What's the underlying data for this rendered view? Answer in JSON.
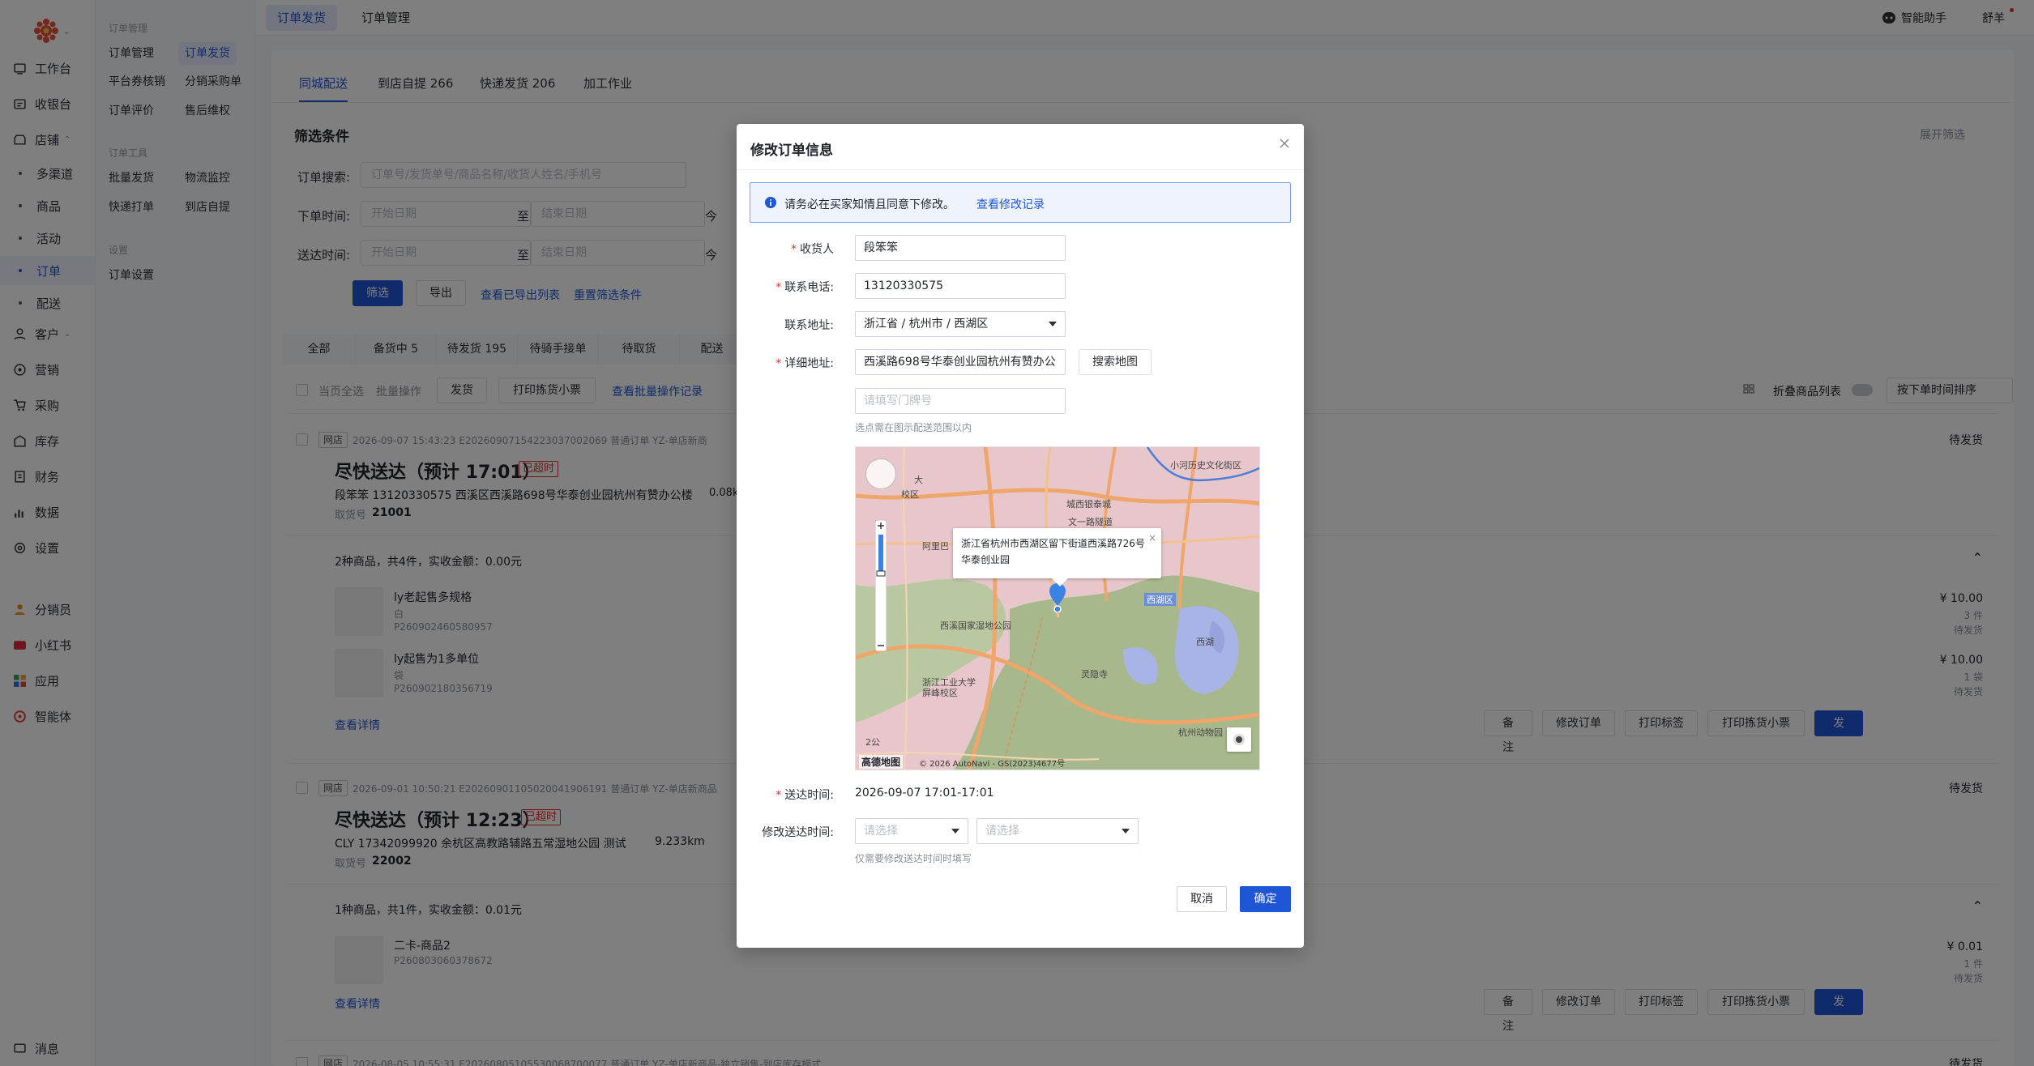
{
  "sidebar": {
    "items": [
      {
        "label": "工作台",
        "icon": "home-icon"
      },
      {
        "label": "收银台",
        "icon": "register-icon"
      },
      {
        "label": "店铺",
        "icon": "store-icon"
      },
      {
        "label": "多渠道",
        "sub": true
      },
      {
        "label": "商品",
        "sub": true
      },
      {
        "label": "活动",
        "sub": true
      },
      {
        "label": "订单",
        "sub": true,
        "active": true
      },
      {
        "label": "配送",
        "sub": true
      },
      {
        "label": "客户",
        "icon": "customer-icon"
      },
      {
        "label": "营销",
        "icon": "marketing-icon"
      },
      {
        "label": "采购",
        "icon": "cart-icon"
      },
      {
        "label": "库存",
        "icon": "inventory-icon"
      },
      {
        "label": "财务",
        "icon": "finance-icon"
      },
      {
        "label": "数据",
        "icon": "chart-icon"
      },
      {
        "label": "设置",
        "icon": "gear-icon"
      },
      {
        "label": "分销员",
        "icon": "distributor-icon"
      },
      {
        "label": "小红书",
        "icon": "xiaohongshu-icon"
      },
      {
        "label": "应用",
        "icon": "apps-icon"
      },
      {
        "label": "智能体",
        "icon": "agent-icon"
      }
    ],
    "message_label": "消息"
  },
  "subnav": {
    "group1": "订单管理",
    "group2": "订单工具",
    "group3": "设置",
    "links": [
      "订单管理",
      "订单发货",
      "平台券核销",
      "分销采购单",
      "订单评价",
      "售后维权",
      "批量发货",
      "物流监控",
      "快递打单",
      "到店自提",
      "订单设置"
    ]
  },
  "topbar": {
    "tabs": [
      "订单发货",
      "订单管理"
    ],
    "assistant": "智能助手",
    "user": "舒羊"
  },
  "content": {
    "tabs": [
      "同城配送",
      "到店自提 266",
      "快递发货 206",
      "加工作业"
    ],
    "filter_title": "筛选条件",
    "expand": "展开筛选",
    "search_label": "订单搜索:",
    "search_ph": "订单号/发货单号/商品名称/收货人姓名/手机号",
    "order_time_label": "下单时间:",
    "deliver_time_label": "送达时间:",
    "start_ph": "开始日期",
    "end_ph": "结束日期",
    "to": "至",
    "today": "今",
    "btn_filter": "筛选",
    "btn_export": "导出",
    "link_exported": "查看已导出列表",
    "link_reset": "重置筛选条件",
    "status_tabs": [
      "全部",
      "备货中 5",
      "待发货 195",
      "待骑手接单",
      "待取货",
      "配送"
    ],
    "bulk_select": "当页全选",
    "bulk_ops": "批量操作",
    "bulk_ship": "发货",
    "bulk_print": "打印拣货小票",
    "bulk_record": "查看批量操作记录",
    "fold": "折叠商品列表",
    "sort": "按下单时间排序",
    "orders": [
      {
        "tag": "网店",
        "meta": "2026-09-07 15:43:23  E20260907154223037002069  普通订单  YZ-单店新商",
        "title": "尽快送达（预计 17:01）",
        "late": "已超时",
        "addr": "段笨笨  13120330575  西溪区西溪路698号华泰创业园杭州有赞办公楼",
        "dist": "0.08k",
        "pick": "取货号",
        "pick_no": "21001",
        "status": "待发货",
        "summary": "2种商品，共4件，实收金额：0.00元",
        "items": [
          {
            "name": "ly老起售多规格",
            "spec": "白",
            "sku": "P260902460580957",
            "price": "¥ 10.00",
            "qty": "3 件",
            "st": "待发货"
          },
          {
            "name": "ly起售为1多单位",
            "spec": "袋",
            "sku": "P260902180356719",
            "price": "¥ 10.00",
            "qty": "1 袋",
            "st": "待发货"
          }
        ]
      },
      {
        "tag": "网店",
        "meta": "2026-09-01 10:50:21  E20260901105020041906191  普通订单  YZ-单店新商品",
        "title": "尽快送达（预计 12:23）",
        "late": "已超时",
        "addr": "CLY  17342099920  余杭区高教路辅路五常湿地公园 测试",
        "dist": "9.233km",
        "pick": "取货号",
        "pick_no": "22002",
        "status": "待发货",
        "summary": "1种商品，共1件，实收金额：0.01元",
        "items": [
          {
            "name": "二卡-商品2",
            "spec": "",
            "sku": "P260803060378672",
            "price": "¥ 0.01",
            "qty": "1 件",
            "st": "待发货"
          }
        ]
      },
      {
        "tag": "网店",
        "meta": "2026-08-05 10:55:31  E20260805105530068700077  普通订单  YZ-单店新商品-独立销售-到店库存模式",
        "status": "待发货"
      }
    ],
    "details": "查看详情",
    "actions": [
      "备注",
      "修改订单",
      "打印标签",
      "打印拣货小票",
      "发货"
    ]
  },
  "modal": {
    "title": "修改订单信息",
    "notice": "请务必在买家知情且同意下修改。",
    "notice_link": "查看修改记录",
    "receiver_label": "收货人",
    "receiver": "段笨笨",
    "phone_label": "联系电话:",
    "phone": "13120330575",
    "region_label": "联系地址:",
    "region": "浙江省 / 杭州市 / 西湖区",
    "detail_label": "详细地址:",
    "detail": "西溪路698号华泰创业园杭州有赞办公",
    "search_map": "搜索地图",
    "door_ph": "请填写门牌号",
    "map_hint": "选点需在图示配送范围以内",
    "popup": "浙江省杭州市西湖区留下街道西溪路726号华泰创业园",
    "map_labels": [
      "小河历史文化街区",
      "城西银泰城",
      "文一路隧道",
      "阿里巴",
      "西溪国家湿地公园",
      "西湖区",
      "西湖",
      "灵隐寺",
      "浙江工业大学屏峰校区",
      "杭州动物园",
      "2公",
      "大",
      "校区"
    ],
    "map_logo": "高德地图",
    "map_copy": "© 2026 AutoNavi - GS(2023)4677号",
    "deliver_label": "送达时间:",
    "deliver_time": "2026-09-07 17:01-17:01",
    "modify_label": "修改送达时间:",
    "select_ph": "请选择",
    "modify_hint": "仅需要修改送达时间时填写",
    "cancel": "取消",
    "confirm": "确定"
  },
  "colors": {
    "primary": "#1f56d6",
    "danger": "#e03131",
    "notice_bg": "#eef3fe"
  }
}
